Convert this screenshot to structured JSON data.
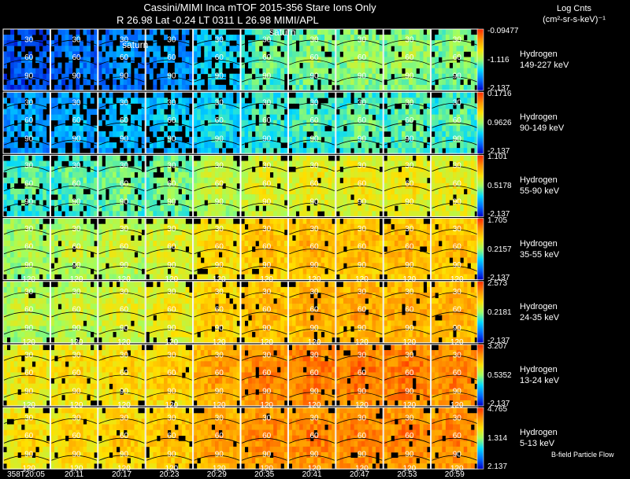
{
  "header": {
    "line1": "Cassini/MIMI Inca mTOF  2015-356    Stare    Ions Only",
    "line2": "R         26.98 Lat -0.24 LT 0311 L         26.98  MIMI/APL"
  },
  "units": {
    "title_line1": "Log Cnts",
    "title_line2": "(cm²-sr-s-keV)⁻¹"
  },
  "saturn_labels": [
    "saturn",
    "saturn"
  ],
  "footer_note": "B-field Particle Flow",
  "chart_data": {
    "type": "heatmap",
    "title": "Cassini/MIMI Inca mTOF  2015-356    Stare    Ions Only",
    "x_tick_labels": [
      "358T20:05",
      "20:11",
      "20:17",
      "20:23",
      "20:29",
      "20:35",
      "20:41",
      "20:47",
      "20:53",
      "20:59"
    ],
    "contour_labels": [
      "30",
      "60",
      "90",
      "120"
    ],
    "colorscale": [
      "#0000c8",
      "#0070ff",
      "#00d8ff",
      "#a0ff60",
      "#ffe000",
      "#ff9000",
      "#ff2800"
    ],
    "rows": [
      {
        "species": "Hydrogen",
        "energy": "149-227 keV",
        "color_max": "-0.09477",
        "color_mid": "-1.116",
        "color_min": "-2.137",
        "mean_level": [
          0.08,
          0.12,
          0.15,
          0.18,
          0.28,
          0.38,
          0.42,
          0.45,
          0.45,
          0.42
        ]
      },
      {
        "species": "Hydrogen",
        "energy": "90-149 keV",
        "color_max": "0.1716",
        "color_mid": "0.9626",
        "color_min": "-2.137",
        "mean_level": [
          0.2,
          0.22,
          0.24,
          0.26,
          0.3,
          0.34,
          0.36,
          0.38,
          0.38,
          0.37
        ]
      },
      {
        "species": "Hydrogen",
        "energy": "55-90 keV",
        "color_max": "1.101",
        "color_mid": "0.5178",
        "color_min": "-2.137",
        "mean_level": [
          0.36,
          0.38,
          0.4,
          0.42,
          0.5,
          0.55,
          0.57,
          0.58,
          0.58,
          0.57
        ]
      },
      {
        "species": "Hydrogen",
        "energy": "35-55 keV",
        "color_max": "1.705",
        "color_mid": "0.2157",
        "color_min": "-2.137",
        "mean_level": [
          0.47,
          0.5,
          0.52,
          0.55,
          0.63,
          0.68,
          0.7,
          0.7,
          0.7,
          0.69
        ]
      },
      {
        "species": "Hydrogen",
        "energy": "24-35 keV",
        "color_max": "2.573",
        "color_mid": "0.2181",
        "color_min": "-2.137",
        "mean_level": [
          0.5,
          0.52,
          0.55,
          0.58,
          0.66,
          0.7,
          0.72,
          0.73,
          0.73,
          0.72
        ]
      },
      {
        "species": "Hydrogen",
        "energy": "13-24 keV",
        "color_max": "3.207",
        "color_mid": "0.5352",
        "color_min": "-2.137",
        "mean_level": [
          0.6,
          0.62,
          0.64,
          0.66,
          0.74,
          0.8,
          0.82,
          0.82,
          0.82,
          0.8
        ]
      },
      {
        "species": "Hydrogen",
        "energy": "5-13 keV",
        "color_max": "4.765",
        "color_mid": "1.314",
        "color_min": "2.137",
        "mean_level": [
          0.62,
          0.64,
          0.66,
          0.68,
          0.75,
          0.78,
          0.8,
          0.8,
          0.8,
          0.79
        ]
      }
    ]
  }
}
